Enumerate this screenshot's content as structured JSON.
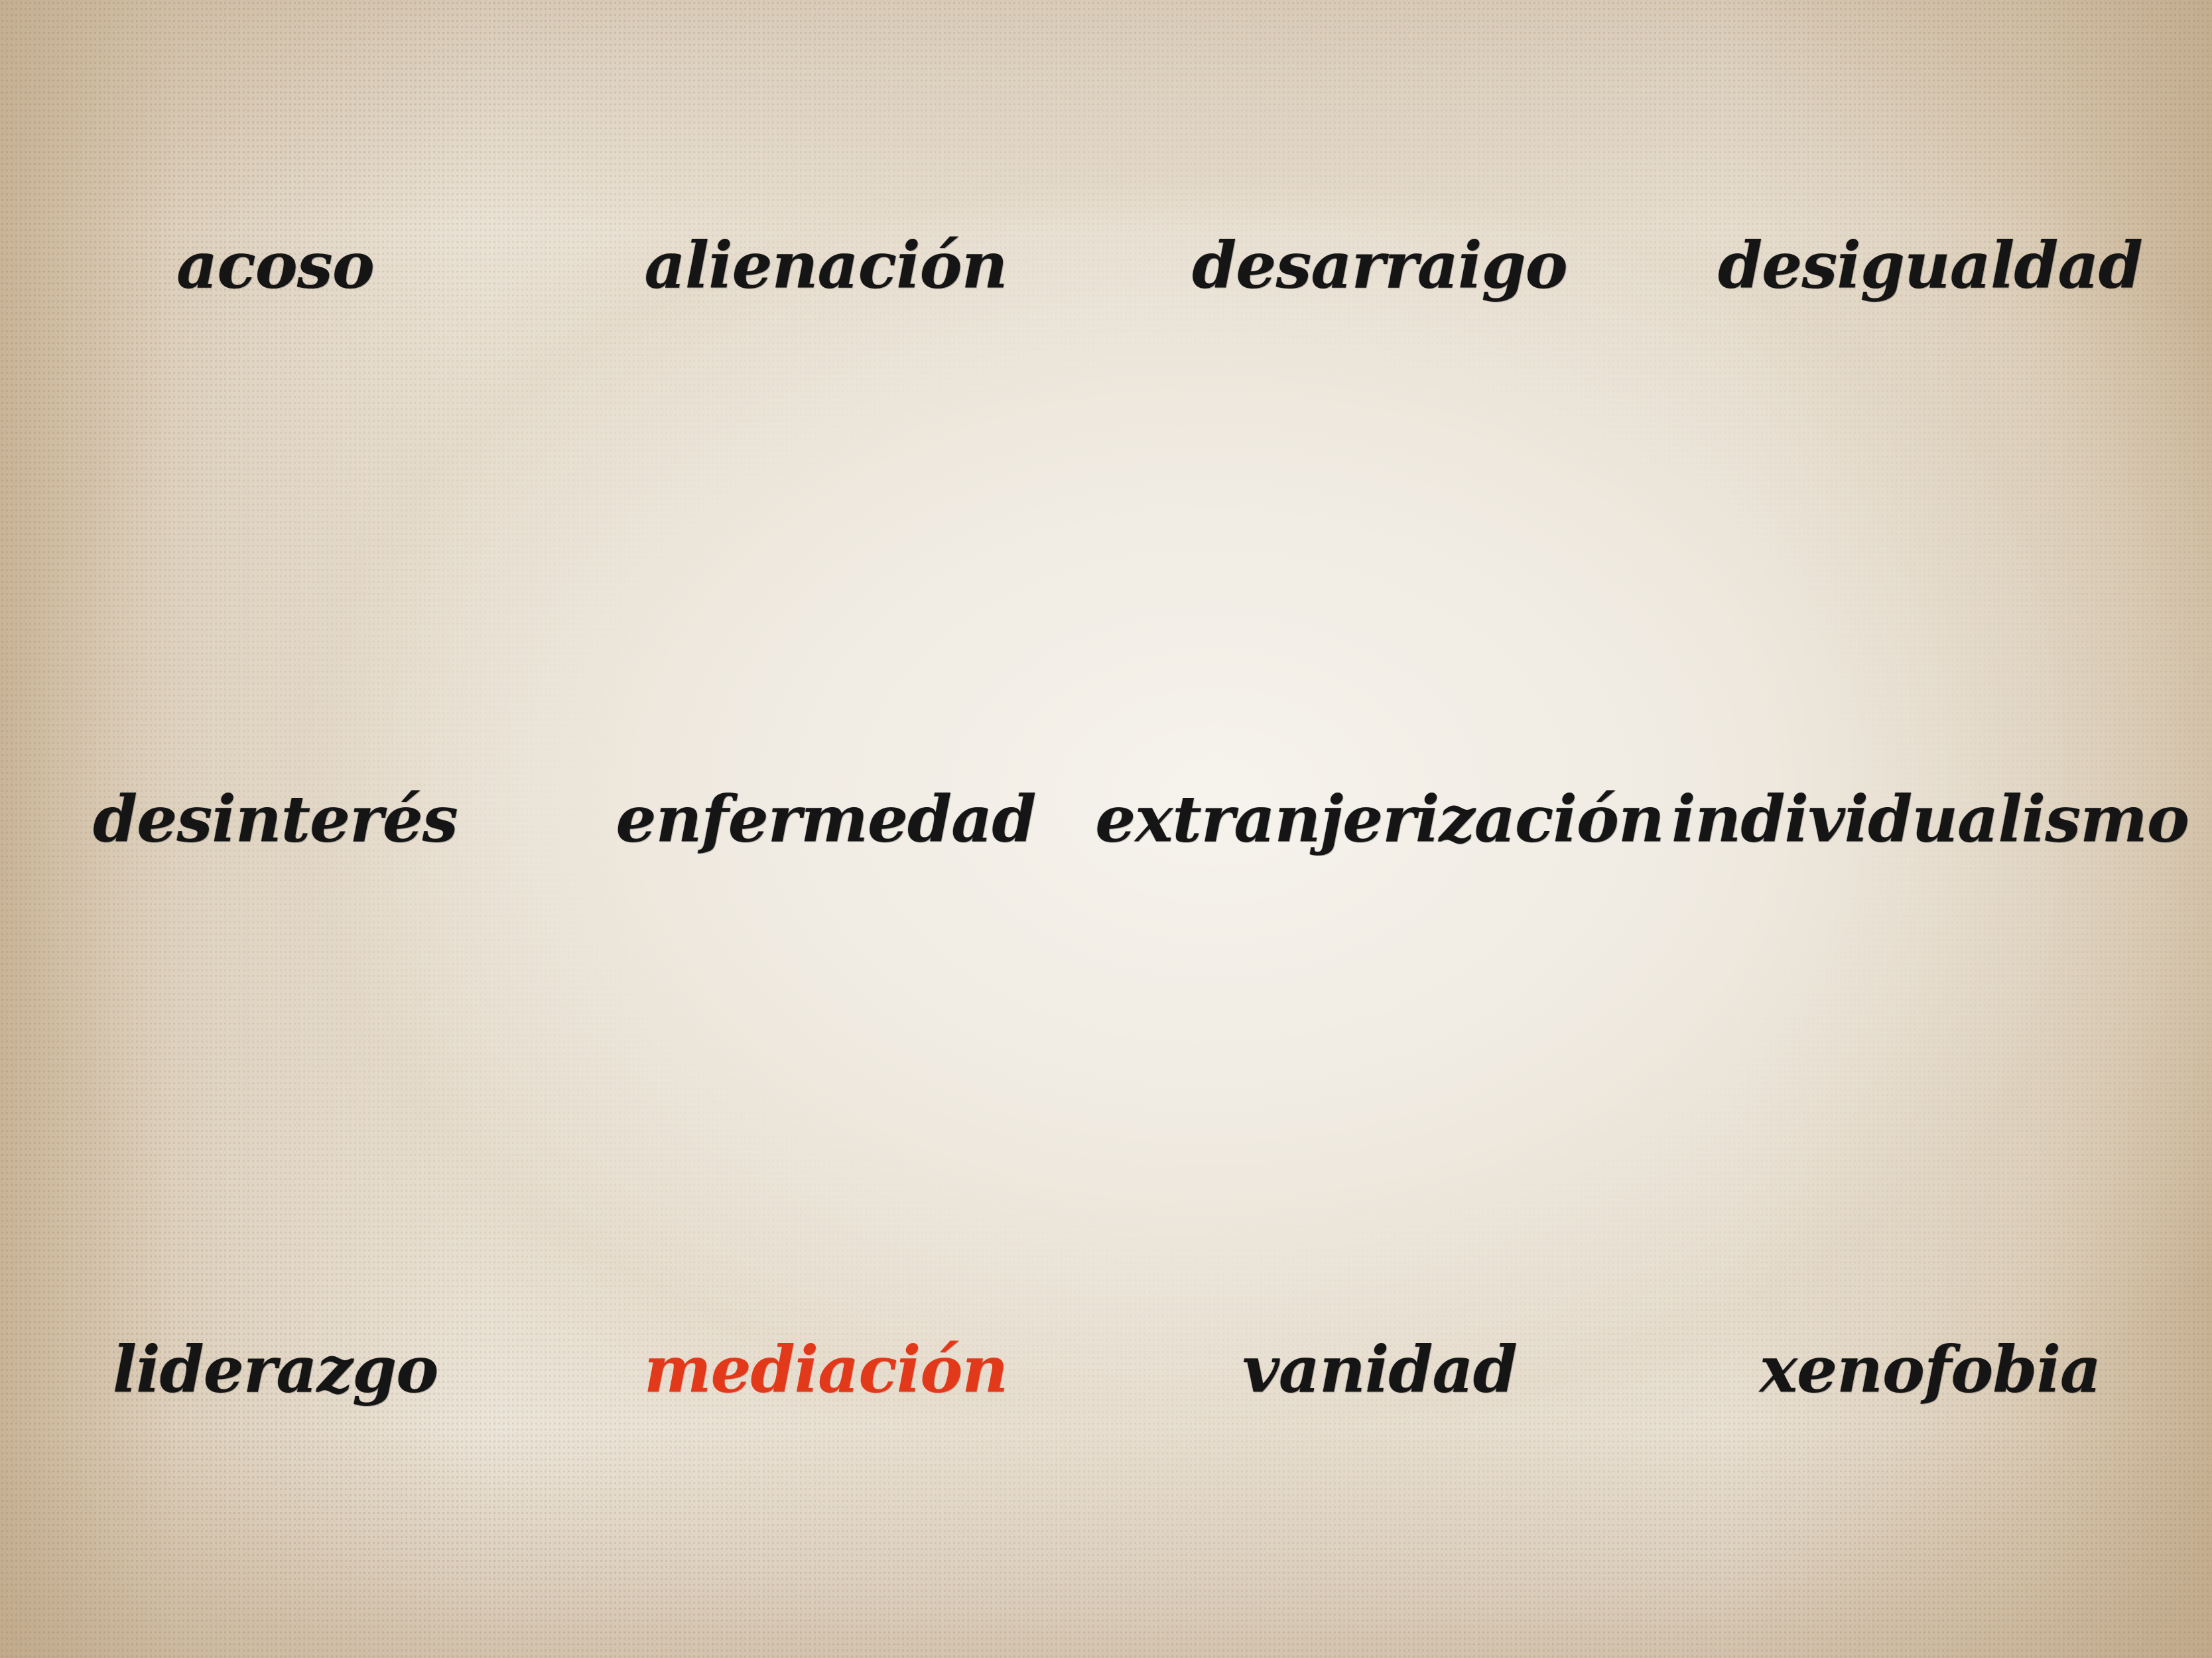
{
  "words": {
    "row1": [
      "acoso",
      "alienación",
      "desarraigo",
      "desigualdad"
    ],
    "row2": [
      "desinterés",
      "enfermedad",
      "extranjerización",
      "individualismo"
    ],
    "row3": [
      "liderazgo",
      "mediación",
      "vanidad",
      "xenofobia"
    ]
  },
  "colors": {
    "background": "#efe9e0",
    "text": "#151515",
    "highlight": "#e2391b"
  },
  "highlighted_word": "mediación"
}
